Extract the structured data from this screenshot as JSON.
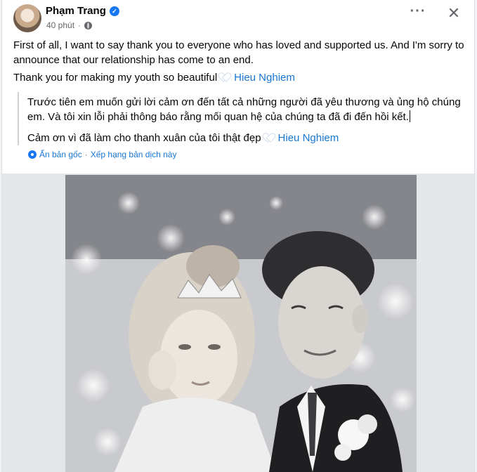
{
  "post": {
    "author": "Phạm Trang",
    "time": "40 phút",
    "more_icon": "more-horizontal-icon",
    "close_label": "✕",
    "english_line1": "First of all, I want to say thank you to everyone who has loved and supported us. And I'm sorry to announce that our relationship has come to an end.",
    "english_line2": "Thank you for making my youth so beautiful",
    "mention": "Hieu Nghiem",
    "translation_p1": "Trước tiên em muốn gửi lời cảm ơn đến tất cả những người đã yêu thương và ủng hộ chúng em. Và tôi xin lỗi phải thông báo rằng mối quan hệ của chúng ta đã đi đến hồi kết.",
    "translation_p2": "Cảm ơn vì đã làm cho thanh xuân của tôi thật đẹp",
    "hide_original": "Ẩn bản gốc",
    "separator": "·",
    "rate_translation": "Xếp hạng bản dịch này"
  },
  "colors": {
    "accent": "#1877f2",
    "mention": "#1876d2",
    "meta": "#65676b"
  }
}
